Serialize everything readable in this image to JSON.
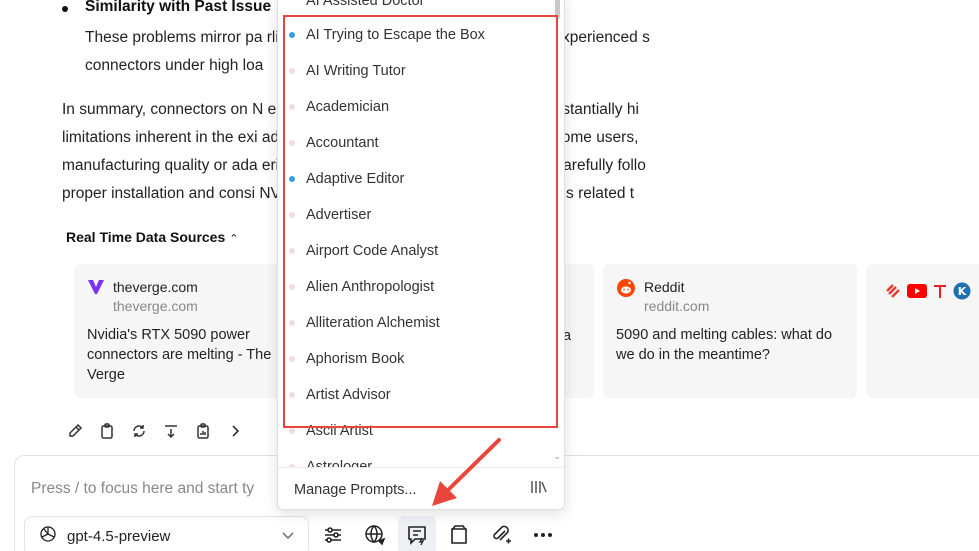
{
  "article": {
    "bullet_title": "Similarity with Past Issue",
    "bullet_lines": [
      "These problems mirror pa                                                          rlier flagship—the RTX 4090—which also experienced s",
      "connectors under high loa"
    ],
    "summary_lines": [
      "In summary, connectors on N                                                              elting due primarily to a combination of substantially hi",
      "limitations inherent in the exi                                                          adequate cable management practices by some users,",
      "manufacturing quality or ada                                                              ering or owning an RTX 5090 GPU should carefully follo",
      "proper installation and consi                                                             NVIDIA regarding possible solutions or recalls related t"
    ]
  },
  "sources": {
    "heading": "Real Time Data Sources",
    "cards": [
      {
        "name": "theverge.com",
        "domain": "theverge.com",
        "title_lines": [
          "Nvidia's RTX 5090 power",
          "connectors are melting - The",
          "Verge"
        ]
      },
      {
        "name": "",
        "domain": "",
        "title_lines": [
          "a"
        ]
      },
      {
        "name": "Reddit",
        "domain": "reddit.com",
        "title_lines": [
          "5090 and melting cables: what do",
          "we do in the meantime?"
        ]
      }
    ]
  },
  "composer": {
    "placeholder": "Press / to focus here and start ty",
    "model": "gpt-4.5-preview"
  },
  "prompt_menu": {
    "top_cut_label": "AI Assisted Doctor",
    "items": [
      {
        "label": "AI Trying to Escape the Box",
        "dot": "#3aa0e0"
      },
      {
        "label": "AI Writing Tutor",
        "dot": "#f0dce0"
      },
      {
        "label": "Academician",
        "dot": "#f0dce0"
      },
      {
        "label": "Accountant",
        "dot": "#f0dce0"
      },
      {
        "label": "Adaptive Editor",
        "dot": "#3aa0e0"
      },
      {
        "label": "Advertiser",
        "dot": "#f0dce0"
      },
      {
        "label": "Airport Code Analyst",
        "dot": "#f0dce0"
      },
      {
        "label": "Alien Anthropologist",
        "dot": "#f0dce0"
      },
      {
        "label": "Alliteration Alchemist",
        "dot": "#f0dce0"
      },
      {
        "label": "Aphorism Book",
        "dot": "#f0dce0"
      },
      {
        "label": "Artist Advisor",
        "dot": "#f0dce0"
      },
      {
        "label": "Ascii Artist",
        "dot": "#f0dce0"
      },
      {
        "label": "Astrologer",
        "dot": "#f0dce0"
      }
    ],
    "footer_label": "Manage Prompts..."
  },
  "colors": {
    "highlight": "#e8453c",
    "accent_dot": "#3aa0e0"
  }
}
